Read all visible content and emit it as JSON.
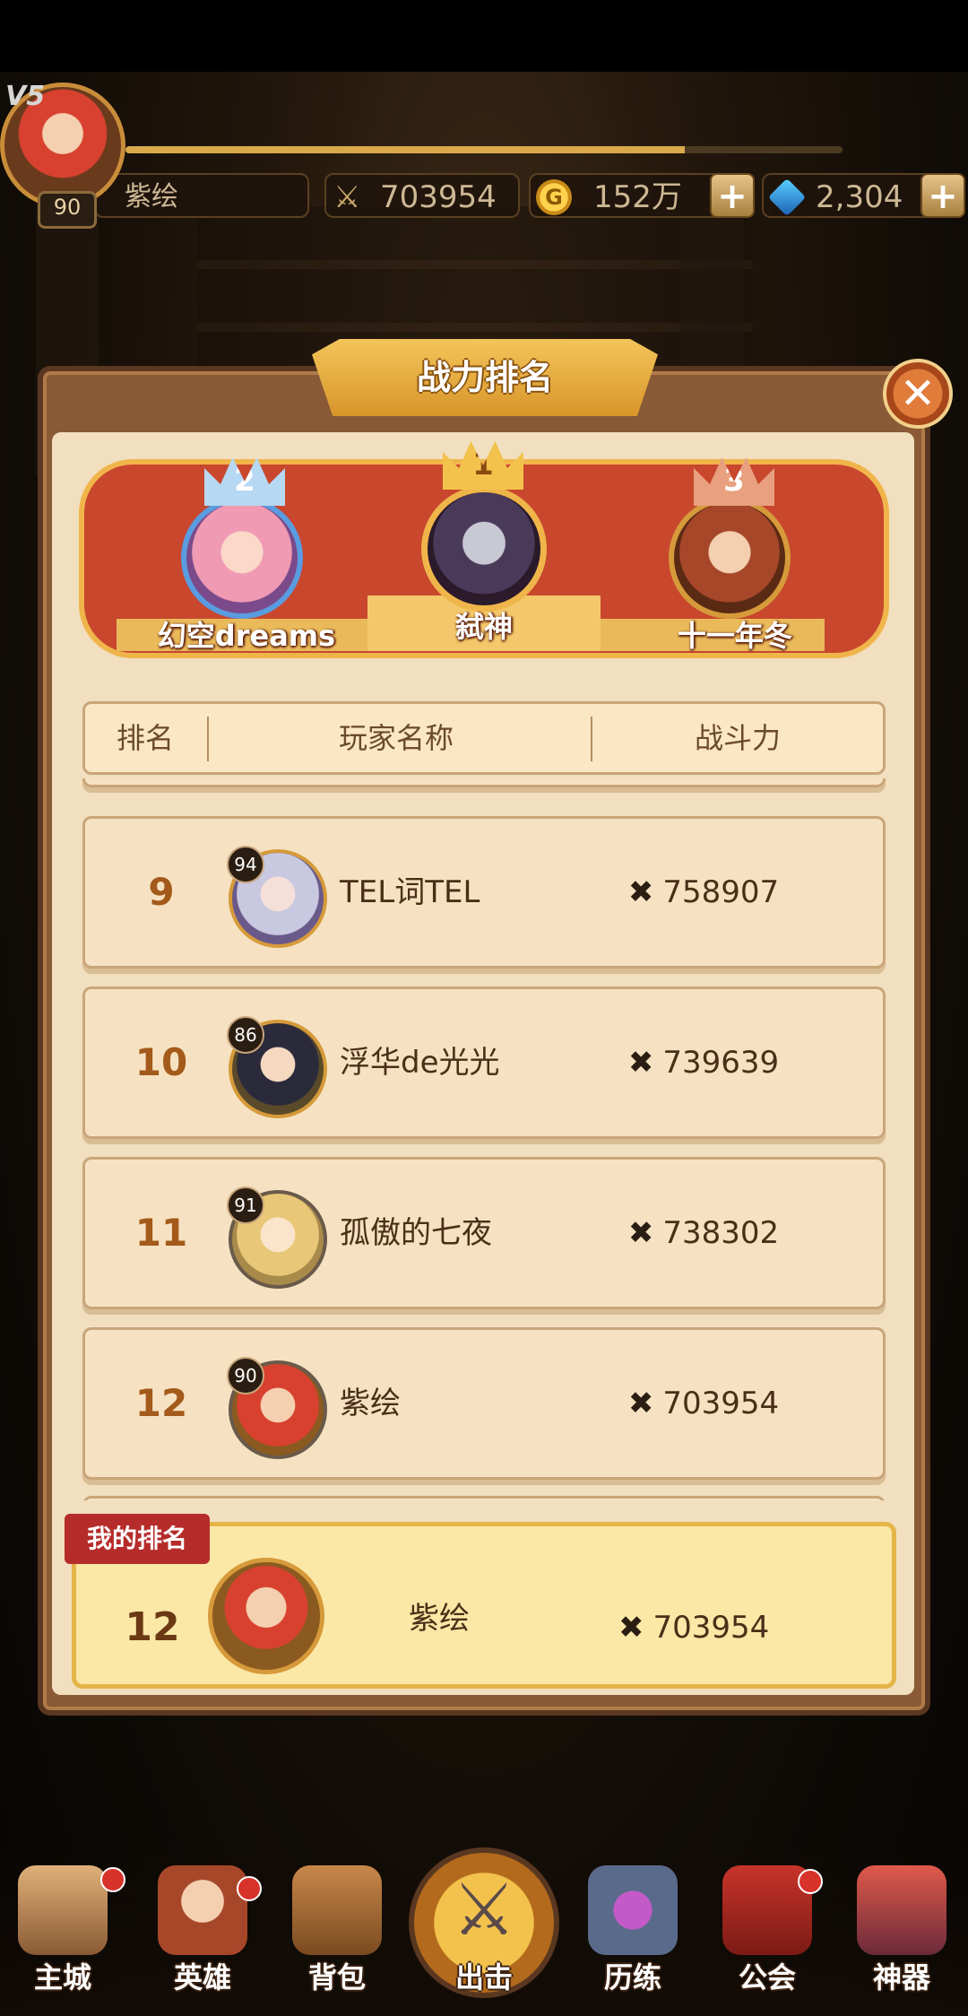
{
  "top_bar": {
    "vip": "V5",
    "level": "90",
    "player_name": "紫绘",
    "power": "703954",
    "gold": "152万",
    "gold_icon": "G",
    "gems": "2,304",
    "plus": "+",
    "xp_fraction": 0.78
  },
  "panel": {
    "title": "战力排名",
    "close": "✕"
  },
  "podium": [
    {
      "rank": "2",
      "name": "幻空dreams"
    },
    {
      "rank": "1",
      "name": "弑神"
    },
    {
      "rank": "3",
      "name": "十一年冬"
    }
  ],
  "table": {
    "headers": [
      "排名",
      "玩家名称",
      "战斗力"
    ],
    "rows": [
      {
        "rank": "9",
        "level": "94",
        "name": "TEL词TEL",
        "power": "758907"
      },
      {
        "rank": "10",
        "level": "86",
        "name": "浮华de光光",
        "power": "739639"
      },
      {
        "rank": "11",
        "level": "91",
        "name": "孤傲的七夜",
        "power": "738302"
      },
      {
        "rank": "12",
        "level": "90",
        "name": "紫绘",
        "power": "703954"
      }
    ]
  },
  "my_rank": {
    "tag": "我的排名",
    "rank": "12",
    "name": "紫绘",
    "power": "703954"
  },
  "bottom_nav": [
    {
      "label": "主城",
      "icon": "castle-icon"
    },
    {
      "label": "英雄",
      "icon": "hero-icon"
    },
    {
      "label": "背包",
      "icon": "backpack-icon"
    },
    {
      "label": "出击",
      "icon": "crossed-swords-icon"
    },
    {
      "label": "历练",
      "icon": "portal-icon"
    },
    {
      "label": "公会",
      "icon": "guild-banner-icon"
    },
    {
      "label": "神器",
      "icon": "artifact-icon"
    }
  ],
  "colors": {
    "accent_gold": "#f3c55a",
    "podium_red": "#c8472d",
    "rank_text": "#a35a1a",
    "badge_red": "#b52c2a"
  }
}
